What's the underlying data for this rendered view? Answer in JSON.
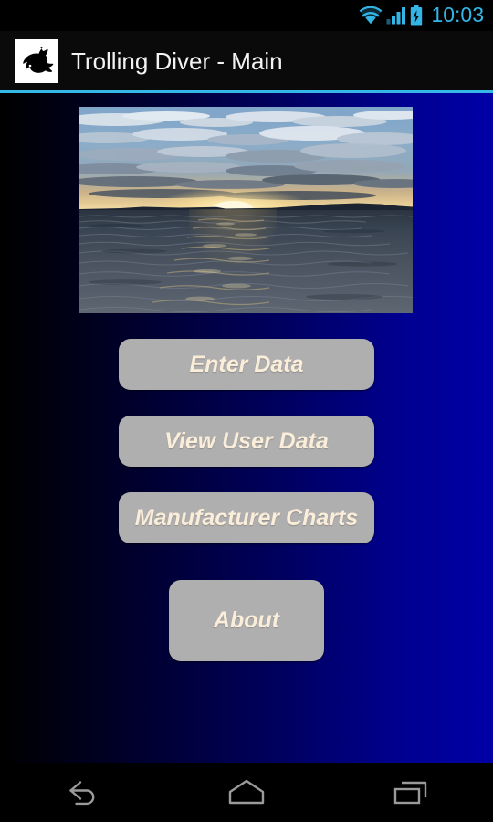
{
  "status_bar": {
    "time": "10:03",
    "icons": [
      "wifi-icon",
      "cellular-signal-icon",
      "battery-charging-icon"
    ],
    "icon_color": "#33B5E5",
    "background": "#000000"
  },
  "action_bar": {
    "title": "Trolling Diver - Main",
    "logo_icon": "fish-logo-icon",
    "logo_background": "#FFFFFF",
    "title_color": "#F2F2F2",
    "divider_color": "#35B7E8",
    "background": "#0A0A0A"
  },
  "content": {
    "background_gradient_from": "#000000",
    "background_gradient_to": "#0000A6",
    "hero_image": {
      "name": "lake-sunset-photo",
      "description": "Sunset over a lake with clouds, island silhouette on horizon and rippling water"
    },
    "buttons": [
      {
        "id": "enter-data",
        "label": "Enter Data"
      },
      {
        "id": "view-user-data",
        "label": "View User Data"
      },
      {
        "id": "manufacturer-charts",
        "label": "Manufacturer Charts"
      },
      {
        "id": "about",
        "label": "About"
      }
    ],
    "button_face_color": "#AFAFAF",
    "button_text_color": "#FAEDD9"
  },
  "nav_bar": {
    "background": "#000000",
    "icon_color": "#9A9A9A",
    "buttons": [
      {
        "id": "back",
        "icon": "back-arrow-icon"
      },
      {
        "id": "home",
        "icon": "home-pentagon-icon"
      },
      {
        "id": "recents",
        "icon": "recent-apps-icon"
      }
    ]
  }
}
